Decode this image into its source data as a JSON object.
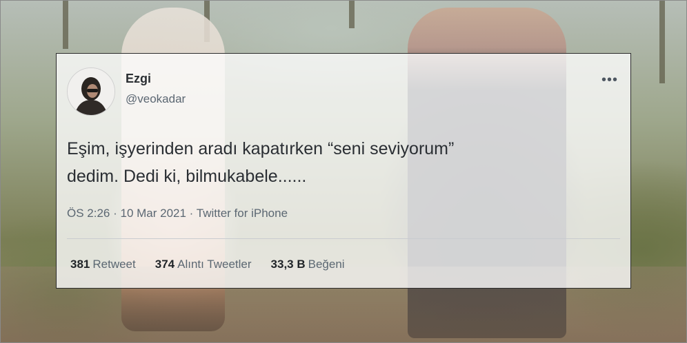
{
  "tweet": {
    "author": {
      "name": "Ezgi",
      "handle": "@veokadar",
      "avatar": "avatar-icon"
    },
    "more_icon": "more-icon",
    "more_label": "•••",
    "text_line1": "Eşim, işyerinden aradı kapatırken “seni seviyorum”",
    "text_line2": "dedim. Dedi ki, bilmukabele......",
    "time": "ÖS 2:26",
    "separator1": " · ",
    "date": "10 Mar 2021",
    "separator2": " · ",
    "source": "Twitter for iPhone",
    "stats": {
      "retweets_count": "381",
      "retweets_label": "Retweet",
      "quotes_count": "374",
      "quotes_label": "Alıntı Tweetler",
      "likes_count": "33,3 B",
      "likes_label": "Beğeni"
    }
  },
  "colors": {
    "name": "#2b2f33",
    "secondary": "#5b6772",
    "body": "#2a2e33",
    "card_bg": "#fcfcfc",
    "card_border": "#2b2b2b"
  }
}
